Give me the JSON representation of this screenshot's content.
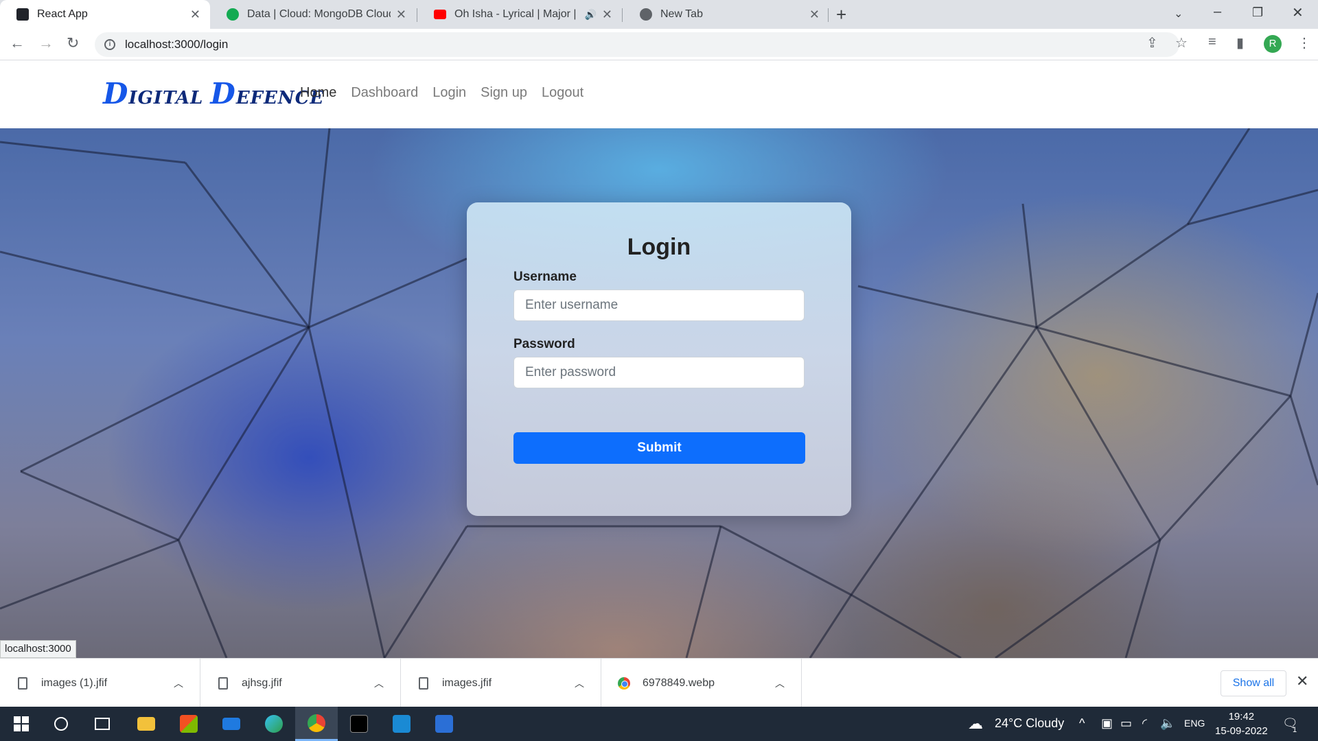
{
  "browser": {
    "tabs": [
      {
        "title": "React App",
        "favicon_color": "#20232a",
        "active": true
      },
      {
        "title": "Data | Cloud: MongoDB Cloud",
        "favicon_color": "#13aa52",
        "active": false
      },
      {
        "title": "Oh Isha - Lyrical | Major | Adi",
        "favicon_color": "#ff0000",
        "active": false
      },
      {
        "title": "New Tab",
        "favicon_color": "#5f6368",
        "active": false
      }
    ],
    "url": "localhost:3000/login",
    "profile_initial": "R"
  },
  "app": {
    "brand": {
      "d1": "D",
      "rest1": "IGITAL",
      "d2": "D",
      "rest2": "EFENCE"
    },
    "nav": [
      "Home",
      "Dashboard",
      "Login",
      "Sign up",
      "Logout"
    ]
  },
  "login": {
    "title": "Login",
    "username_label": "Username",
    "username_placeholder": "Enter username",
    "password_label": "Password",
    "password_placeholder": "Enter password",
    "submit_label": "Submit"
  },
  "status_url": "localhost:3000",
  "downloads": {
    "items": [
      "images (1).jfif",
      "ajhsg.jfif",
      "images.jfif",
      "6978849.webp"
    ],
    "show_all": "Show all"
  },
  "taskbar": {
    "weather": "24°C  Cloudy",
    "language": "ENG",
    "time": "19:42",
    "date": "15-09-2022",
    "notifications": "1"
  }
}
